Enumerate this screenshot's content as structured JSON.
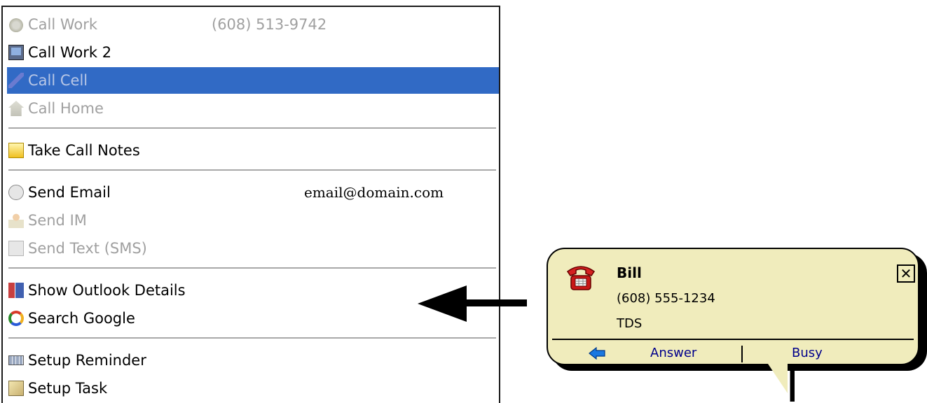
{
  "menu": {
    "items": [
      {
        "label": "Call Work",
        "extra": "(608) 513-9742",
        "icon": "phone-icon",
        "state": "disabled"
      },
      {
        "label": "Call Work 2",
        "icon": "monitor-icon",
        "state": "normal"
      },
      {
        "label": "Call Cell",
        "icon": "cellphone-icon",
        "state": "selected"
      },
      {
        "label": "Call Home",
        "icon": "home-icon",
        "state": "disabled"
      },
      {
        "label": "Take Call Notes",
        "icon": "note-icon",
        "state": "normal"
      },
      {
        "label": "Send Email",
        "extra": "email@domain.com",
        "icon": "mail-icon",
        "state": "normal"
      },
      {
        "label": "Send IM",
        "icon": "im-icon",
        "state": "disabled"
      },
      {
        "label": "Send Text (SMS)",
        "icon": "sms-icon",
        "state": "disabled"
      },
      {
        "label": "Show Outlook Details",
        "icon": "outlook-icon",
        "state": "normal"
      },
      {
        "label": "Search Google",
        "icon": "google-icon",
        "state": "normal"
      },
      {
        "label": "Setup Reminder",
        "icon": "calendar-icon",
        "state": "normal"
      },
      {
        "label": "Setup Task",
        "icon": "task-icon",
        "state": "normal"
      }
    ]
  },
  "popup": {
    "name": "Bill",
    "number": "(608)  555-1234",
    "company": "TDS",
    "close_label": "✕",
    "answer_label": "Answer",
    "busy_label": "Busy"
  },
  "colors": {
    "selection": "#316ac5",
    "popup_bg": "#f0ecbc",
    "link": "#00008b"
  }
}
